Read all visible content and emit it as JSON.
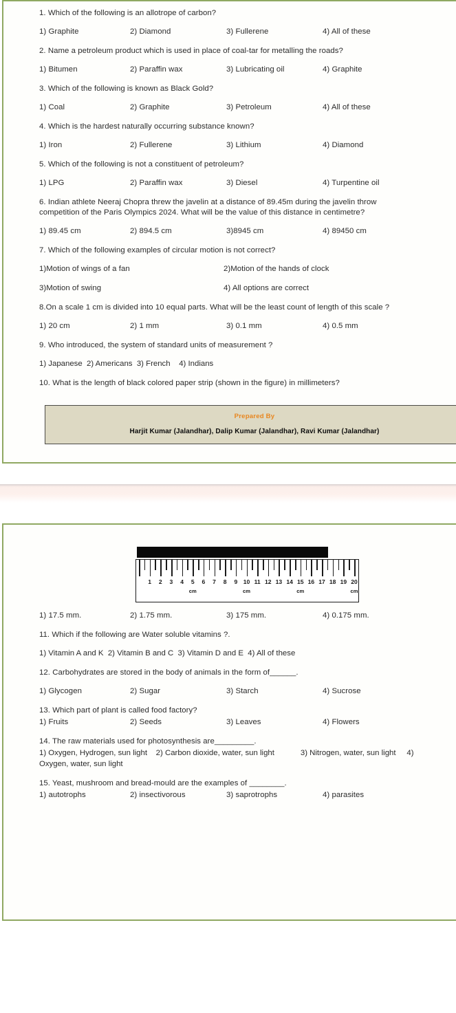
{
  "document": {
    "type": "scanned-worksheet",
    "border_color": "#8fa861",
    "band_color": "#fdf1ed"
  },
  "page1": {
    "questions": [
      {
        "number": "1.",
        "text": "1. Which of the following is an allotrope of carbon?",
        "options": [
          "1) Graphite",
          "2) Diamond",
          "3) Fullerene",
          "4) All of these"
        ]
      },
      {
        "number": "2.",
        "text": "2. Name a petroleum product which is used in place of coal-tar for metalling the roads?",
        "options": [
          "1) Bitumen",
          "2) Paraffin wax",
          "3) Lubricating oil",
          "4) Graphite"
        ]
      },
      {
        "number": "3.",
        "text": "3. Which of the following is known as Black Gold?",
        "options": [
          "1) Coal",
          "2) Graphite",
          "3) Petroleum",
          "4) All of these"
        ]
      },
      {
        "number": "4.",
        "text": "4. Which is the hardest naturally occurring substance known?",
        "options": [
          "1) Iron",
          "2) Fullerene",
          "3) Lithium",
          "4) Diamond"
        ]
      },
      {
        "number": "5.",
        "text": "5. Which of the following is not a constituent of petroleum?",
        "options": [
          "1) LPG",
          "2) Paraffin wax",
          "3) Diesel",
          "4) Turpentine oil"
        ]
      },
      {
        "number": "6.",
        "text": "6. Indian athlete  Neeraj Chopra threw the javelin at a distance of 89.45m during the javelin throw competition of the Paris Olympics 2024. What will be the value of this distance in centimetre?",
        "options": [
          "1) 89.45 cm",
          "2) 894.5 cm",
          "3)8945 cm",
          "4) 89450 cm"
        ]
      },
      {
        "number": "7.",
        "text": "7. Which of the following examples of circular motion is not correct?",
        "options_row1": [
          "1)Motion of wings of a fan",
          "2)Motion of the hands of clock"
        ],
        "options_row2": [
          "3)Motion of swing",
          "4) All options are correct"
        ]
      },
      {
        "number": "8.",
        "text": "8.On a scale 1 cm is divided into 10 equal parts. What will be the least count of length of this scale ?",
        "options": [
          "1) 20 cm",
          "2) 1 mm",
          "3) 0.1 mm",
          "4) 0.5 mm"
        ]
      },
      {
        "number": "9.",
        "text": "9. Who introduced, the system of standard units of measurement ?",
        "options_inline": "1) Japanese  2) Americans  3) French    4) Indians"
      },
      {
        "number": "10.",
        "text": "10. What is the length of black colored paper strip (shown in the figure) in millimeters?"
      }
    ],
    "prepared_by": {
      "title": "Prepared By",
      "names": "Harjit Kumar (Jalandhar), Dalip Kumar (Jalandhar), Ravi Kumar (Jalandhar)",
      "title_color": "#e8861f",
      "background": "#ddd9c3"
    }
  },
  "page2": {
    "figure": {
      "name": "ruler-with-black-paper-strip",
      "scale_numbers": [
        "1",
        "2",
        "3",
        "4",
        "5",
        "6",
        "7",
        "8",
        "9",
        "10",
        "11",
        "12",
        "13",
        "14",
        "15",
        "16",
        "17",
        "18",
        "19",
        "20"
      ],
      "unit_labels": [
        "cm",
        "cm",
        "cm",
        "cm"
      ],
      "unit_label_positions": [
        5,
        10,
        15,
        20
      ],
      "strip_length_cm": 17.5,
      "strip_color": "#0a0a0a",
      "max_value": 20
    },
    "q10_options": [
      "1) 17.5 mm.",
      "2) 1.75 mm.",
      "3) 175 mm.",
      "4) 0.175 mm."
    ],
    "questions": [
      {
        "number": "11.",
        "text": "11. Which if the following are Water soluble vitamins ?.",
        "options_inline": "1) Vitamin A and K  2) Vitamin B and C  3) Vitamin D and E  4) All of these"
      },
      {
        "number": "12.",
        "text": "12. Carbohydrates are stored in the body of animals in the form of______.",
        "options": [
          "1) Glycogen",
          "2) Sugar",
          "3) Starch",
          "4) Sucrose"
        ]
      },
      {
        "number": "13.",
        "text": "13. Which part of plant is called food factory?",
        "options": [
          "1) Fruits",
          "2) Seeds",
          "3) Leaves",
          "4) Flowers"
        ]
      },
      {
        "number": "14.",
        "text": "14. The raw materials used for photosynthesis are_________.",
        "options_flow": "1) Oxygen, Hydrogen, sun light    2) Carbon dioxide, water, sun light            3) Nitrogen, water, sun light     4) Oxygen, water, sun light"
      },
      {
        "number": "15.",
        "text": "15. Yeast, mushroom and bread-mould are the examples of ________.",
        "options": [
          "1) autotrophs",
          "2) insectivorous",
          "3) saprotrophs",
          "4) parasites"
        ]
      }
    ]
  }
}
